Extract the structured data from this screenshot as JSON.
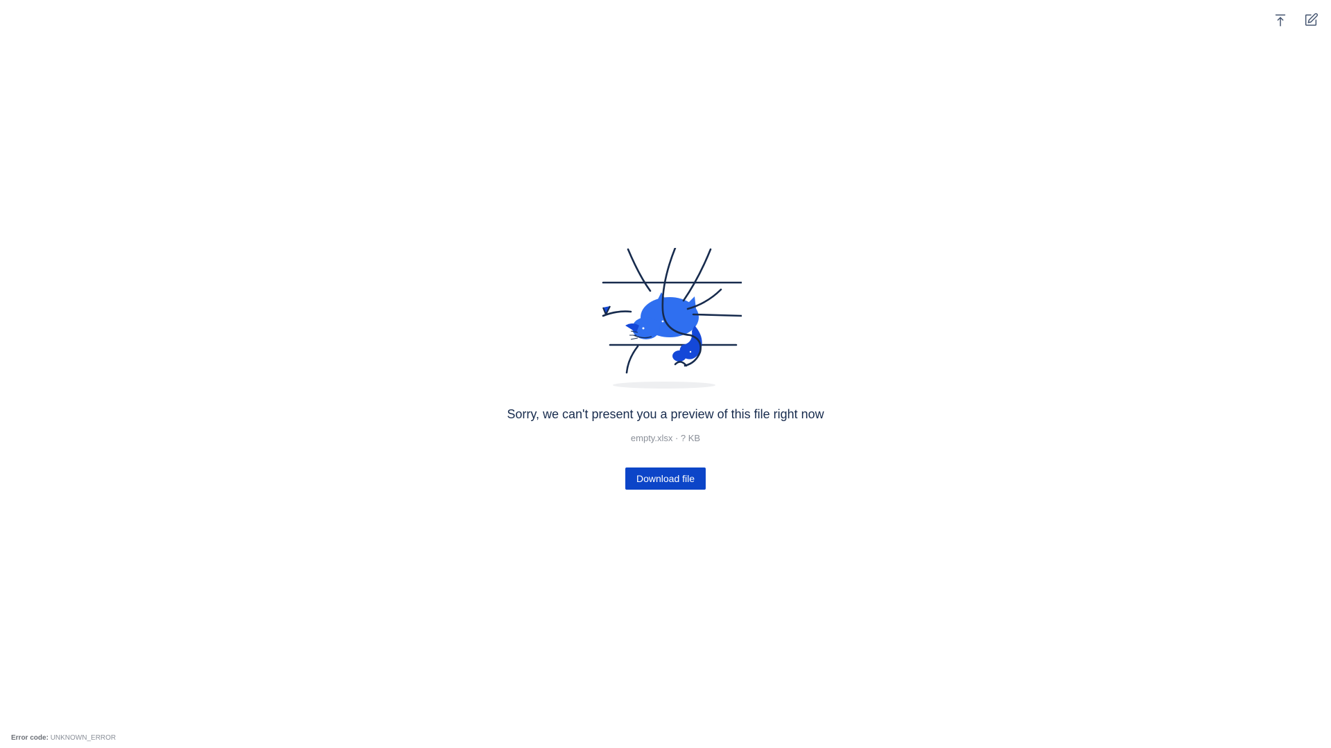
{
  "toolbar": {
    "items": [
      {
        "icon": "upload-icon"
      },
      {
        "icon": "edit-icon"
      }
    ]
  },
  "preview": {
    "message": "Sorry, we can't present you a preview of this file right now",
    "file_name": "empty.xlsx",
    "separator": " · ",
    "file_size": "? KB",
    "download_label": "Download file"
  },
  "footer": {
    "error_label": "Error code:",
    "error_code": "UNKNOWN_ERROR"
  },
  "colors": {
    "accent": "#0c45c8",
    "illustration_blue": "#2f6ff0",
    "illustration_dark_blue": "#1448d8",
    "line": "#172b4d"
  }
}
